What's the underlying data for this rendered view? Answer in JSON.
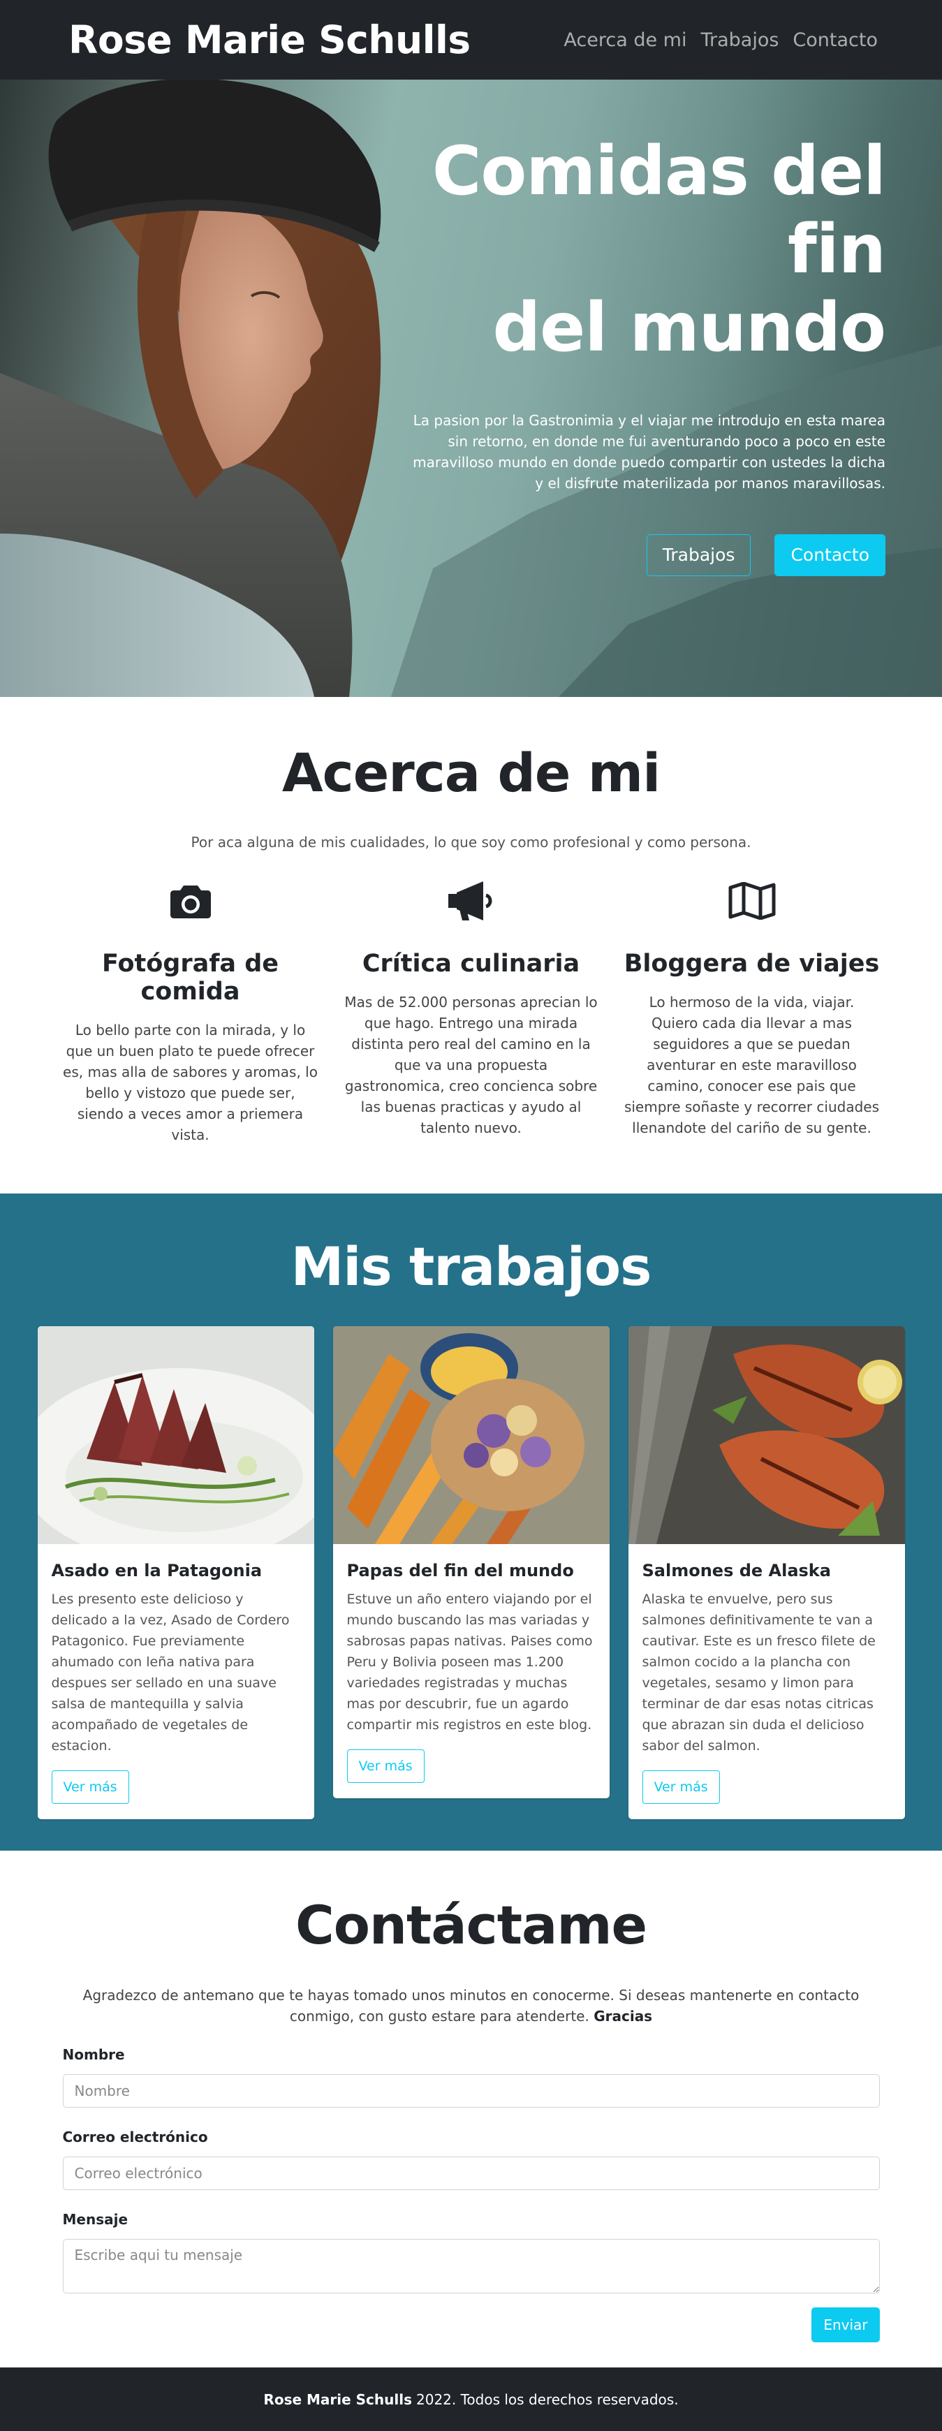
{
  "navbar": {
    "brand": "Rose Marie Schulls",
    "links": [
      "Acerca de mi",
      "Trabajos",
      "Contacto"
    ]
  },
  "hero": {
    "title_lines": [
      "Comidas del",
      "fin",
      "del mundo"
    ],
    "subtitle": "La pasion por la Gastronimia y el viajar me introdujo en esta marea sin retorno, en donde me fui aventurando poco a poco en este maravilloso mundo en donde puedo compartir con ustedes la dicha y el disfrute materilizada por manos maravillosas.",
    "btn_works": "Trabajos",
    "btn_contact": "Contacto",
    "icon": "portrait-photo"
  },
  "about": {
    "title": "Acerca de mi",
    "lead": "Por aca alguna de mis cualidades, lo que soy como profesional y como persona.",
    "features": [
      {
        "icon": "camera-icon",
        "title": "Fotógrafa de comida",
        "text": "Lo bello parte con la mirada, y lo que un buen plato te puede ofrecer es, mas alla de sabores y aromas, lo bello y vistozo que puede ser, siendo a veces amor a priemera vista."
      },
      {
        "icon": "megaphone-icon",
        "title": "Crítica culinaria",
        "text": "Mas de 52.000 personas aprecian lo que hago. Entrego una mirada distinta pero real del camino en la que va una propuesta gastronomica, creo concienca sobre las buenas practicas y ayudo al talento nuevo."
      },
      {
        "icon": "map-icon",
        "title": "Bloggera de viajes",
        "text": "Lo hermoso de la vida, viajar. Quiero cada dia llevar a mas seguidores a que se puedan aventurar en este maravilloso camino, conocer ese pais que siempre soñaste y recorrer ciudades llenandote del cariño de su gente."
      }
    ]
  },
  "works": {
    "title": "Mis trabajos",
    "button_label": "Ver más",
    "cards": [
      {
        "title": "Asado en la Patagonia",
        "text": "Les presento este delicioso y delicado a la vez, Asado de Cordero Patagonico. Fue previamente ahumado con leña nativa para despues ser sellado en una suave salsa de mantequilla y salvia acompañado de vegetales de estacion."
      },
      {
        "title": "Papas del fin del mundo",
        "text": "Estuve un año entero viajando por el mundo buscando las mas variadas y sabrosas papas nativas. Paises como Peru y Bolivia poseen mas 1.200 variedades registradas y muchas mas por descubrir, fue un agardo compartir mis registros en este blog."
      },
      {
        "title": "Salmones de Alaska",
        "text": "Alaska te envuelve, pero sus salmones definitivamente te van a cautivar. Este es un fresco filete de salmon cocido a la plancha con vegetales, sesamo y limon para terminar de dar esas notas citricas que abrazan sin duda el delicioso sabor del salmon."
      }
    ]
  },
  "contact": {
    "title": "Contáctame",
    "lead": "Agradezco de antemano que te hayas tomado unos minutos en conocerme. Si deseas mantenerte en contacto conmigo, con gusto estare para atenderte.",
    "lead_bold": "Gracias",
    "fields": {
      "name_label": "Nombre",
      "name_placeholder": "Nombre",
      "email_label": "Correo electrónico",
      "email_placeholder": "Correo electrónico",
      "message_label": "Mensaje",
      "message_placeholder": "Escribe aqui tu mensaje"
    },
    "submit": "Enviar"
  },
  "footer": {
    "name": "Rose Marie Schulls",
    "text": "2022. Todos los derechos reservados."
  },
  "colors": {
    "dark": "#212529",
    "info": "#0dcaf0",
    "works_bg": "#25718a"
  }
}
